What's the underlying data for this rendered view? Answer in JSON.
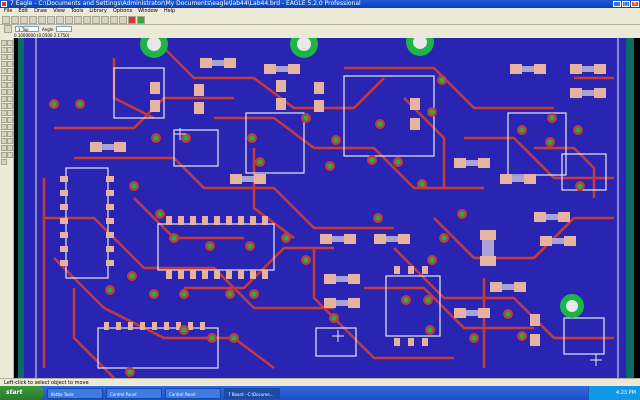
{
  "window": {
    "title": "7 Eagle - C:\\Documents and Settings\\Administrator\\My Documents\\eagle\\lab44\\Lab44.brd - EAGLE 5.2.0 Professional",
    "controls": [
      "_",
      "□",
      "×"
    ]
  },
  "menu": [
    "File",
    "Edit",
    "Draw",
    "View",
    "Tools",
    "Library",
    "Options",
    "Window",
    "Help"
  ],
  "toolbar": {
    "layer_select": "1 Top",
    "grid_label": "Angle"
  },
  "coord": "0.1000000 (0.0500  2.1750)",
  "status": "Left-click to select object to move",
  "taskbar": {
    "start_label": "start",
    "tasks": [
      "Kettle Tools",
      "Control Panel",
      "Control Panel",
      "7 Board - C:\\Docume..."
    ],
    "clock": "4:23 PM"
  },
  "colors": {
    "board_fill": "#2a24b3",
    "trace": "#c63a3a",
    "pad": "#e6b3a0",
    "silkscreen": "#e8e8e8",
    "via": "#1db54a",
    "window_title": "#0a3fb5"
  }
}
